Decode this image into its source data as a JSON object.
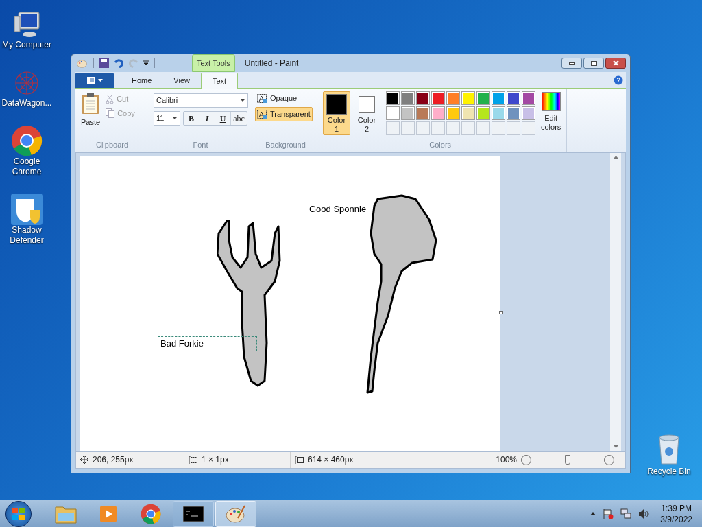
{
  "desktop_icons": [
    {
      "label": "My Computer",
      "kind": "computer"
    },
    {
      "label": "DataWagon...",
      "kind": "web"
    },
    {
      "label": "Google Chrome",
      "kind": "chrome"
    },
    {
      "label": "Shadow Defender",
      "kind": "shield"
    }
  ],
  "recycle_bin": {
    "label": "Recycle Bin"
  },
  "window": {
    "title": "Untitled - Paint",
    "contextual_tab": "Text Tools",
    "tabs": [
      {
        "label": "Home",
        "selected": false
      },
      {
        "label": "View",
        "selected": false
      },
      {
        "label": "Text",
        "selected": true
      }
    ],
    "clipboard": {
      "paste": "Paste",
      "cut": "Cut",
      "copy": "Copy",
      "group": "Clipboard"
    },
    "font": {
      "family": "Calibri",
      "size": "11",
      "styles": [
        {
          "label": "B",
          "kind": "bold"
        },
        {
          "label": "I",
          "kind": "italic"
        },
        {
          "label": "U",
          "kind": "underline"
        },
        {
          "label": "abc",
          "kind": "strike"
        }
      ],
      "group": "Font"
    },
    "background": {
      "options": [
        {
          "label": "Opaque",
          "selected": false
        },
        {
          "label": "Transparent",
          "selected": true
        }
      ],
      "group": "Background"
    },
    "colors": {
      "color1": {
        "label": "Color",
        "number": "1",
        "color": "#000000",
        "selected": true
      },
      "color2": {
        "label": "Color",
        "number": "2",
        "color": "#ffffff",
        "selected": false
      },
      "palette": [
        {
          "color": "#000000"
        },
        {
          "color": "#7f7f7f"
        },
        {
          "color": "#880015"
        },
        {
          "color": "#ed1c24"
        },
        {
          "color": "#ff7f27"
        },
        {
          "color": "#fff200"
        },
        {
          "color": "#22b14c"
        },
        {
          "color": "#00a2e8"
        },
        {
          "color": "#3f48cc"
        },
        {
          "color": "#a349a4"
        },
        {
          "color": "#ffffff"
        },
        {
          "color": "#c3c3c3"
        },
        {
          "color": "#b97a57"
        },
        {
          "color": "#ffaec9"
        },
        {
          "color": "#ffc90e"
        },
        {
          "color": "#efe4b0"
        },
        {
          "color": "#b5e61d"
        },
        {
          "color": "#99d9ea"
        },
        {
          "color": "#7092be"
        },
        {
          "color": "#c8bfe7"
        }
      ],
      "edit": "Edit colors",
      "group": "Colors"
    },
    "canvas": {
      "texts": [
        {
          "text": "Good Sponnie",
          "editing": false
        },
        {
          "text": "Bad Forkie",
          "editing": true
        }
      ]
    },
    "status_bar": {
      "cursor": "206, 255px",
      "selection": "1 × 1px",
      "size": "614 × 460px",
      "zoom": "100%",
      "zoom_slider": {
        "level": 0.5
      }
    }
  },
  "taskbar": {
    "apps": [
      {
        "kind": "explorer",
        "selected": false,
        "open": false
      },
      {
        "kind": "media",
        "selected": false,
        "open": false
      },
      {
        "kind": "chrome",
        "selected": false,
        "open": false
      },
      {
        "kind": "cmd",
        "selected": false,
        "open": true
      },
      {
        "kind": "paint",
        "selected": true,
        "open": true
      }
    ],
    "time": "1:39 PM",
    "date": "3/9/2022"
  }
}
